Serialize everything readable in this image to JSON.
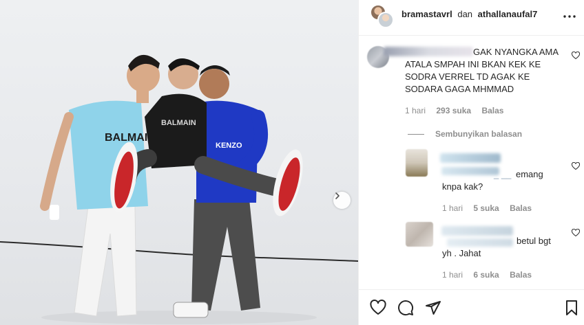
{
  "header": {
    "user1": "bramastavrl",
    "conjunction": "dan",
    "user2": "athallanaufal7"
  },
  "icons": {
    "more": "more-horizontal-icon",
    "like": "heart-icon",
    "comment": "comment-icon",
    "share": "paper-plane-icon",
    "save": "bookmark-icon",
    "next": "chevron-right-icon"
  },
  "comments": [
    {
      "text_line1": "GAK NYANGKA AMA",
      "text_rest": "ATALA SMPAH INI BKAN KEK KE SODRA VERREL TD AGAK KE SODARA GAGA MHMMAD",
      "time": "1 hari",
      "likes": "293 suka",
      "reply": "Balas"
    }
  ],
  "hide_replies": "Sembunyikan balasan",
  "replies": [
    {
      "name_tail": "_ __",
      "text_line1": "emang",
      "text_rest": "knpa kak?",
      "time": "1 hari",
      "likes": "5 suka",
      "reply": "Balas"
    },
    {
      "text_line1": "betul bgt",
      "text_rest": "yh . Jahat",
      "time": "1 hari",
      "likes": "6 suka",
      "reply": "Balas"
    }
  ],
  "colors": {
    "text": "#262626",
    "secondary": "#8e8e8e",
    "divider": "#efefef"
  }
}
